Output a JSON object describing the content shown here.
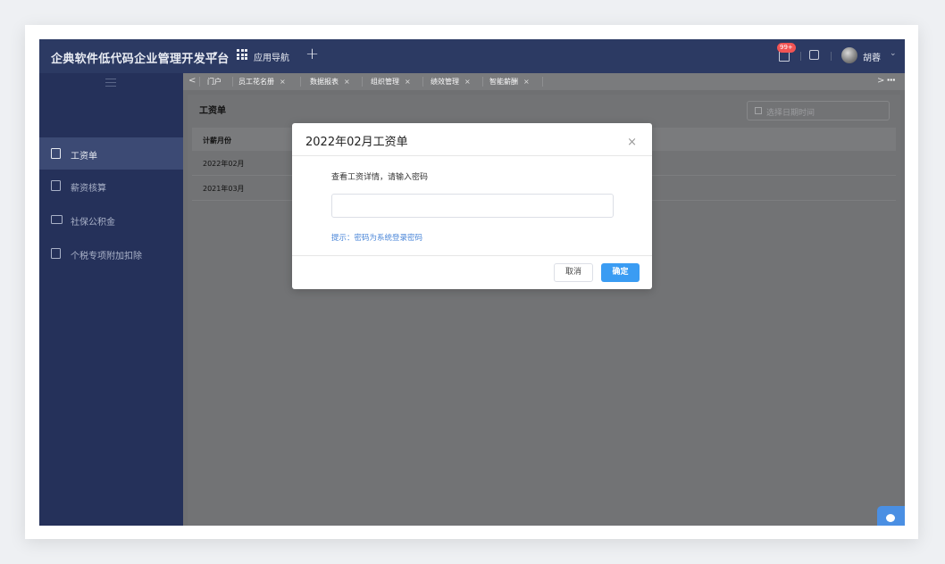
{
  "header": {
    "brand": "企典软件低代码企业管理开发平台",
    "brand_caret": "▾",
    "nav_label": "应用导航",
    "add": "+",
    "notification_badge": "99+",
    "username": "胡蓉",
    "user_caret": "⌄"
  },
  "sidebar": {
    "items": [
      {
        "label": "工资单",
        "active": true
      },
      {
        "label": "薪资核算"
      },
      {
        "label": "社保公积金"
      },
      {
        "label": "个税专项附加扣除"
      }
    ]
  },
  "tabs": {
    "prev": "<",
    "next": ">",
    "more": "···",
    "close": "×",
    "items": [
      {
        "label": "门户"
      },
      {
        "label": "员工花名册"
      },
      {
        "label": "数据报表"
      },
      {
        "label": "组织管理"
      },
      {
        "label": "绩效管理"
      },
      {
        "label": "智能薪酬",
        "active": true
      }
    ]
  },
  "page": {
    "title": "工资单",
    "date_placeholder": "选择日期时间",
    "table": {
      "header": "计薪月份",
      "rows": [
        "2022年02月",
        "2021年03月"
      ]
    }
  },
  "modal": {
    "title": "2022年02月工资单",
    "close": "×",
    "description": "查看工资详情，请输入密码",
    "password_value": "",
    "hint": "提示：密码为系统登录密码",
    "cancel": "取消",
    "confirm": "确定"
  },
  "colors": {
    "header_bg": "#2c3a63",
    "sidebar_bg": "#25315a",
    "primary_button": "#3a9cf3",
    "hint_text": "#4a86d8",
    "badge": "#f25454"
  },
  "icons": {
    "nav": "grid-icon",
    "notification": "bell-icon",
    "edit": "edit-icon",
    "calendar": "calendar-icon",
    "chat": "chat-icon"
  }
}
